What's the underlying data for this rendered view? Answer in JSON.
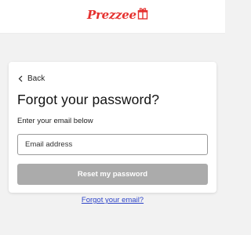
{
  "brand": {
    "logo_text": "Prezzee",
    "accent": "#e5302e"
  },
  "form": {
    "back_label": "Back",
    "title": "Forgot your password?",
    "hint": "Enter your email below",
    "email_placeholder": "Email address",
    "email_value": "",
    "submit_label": "Reset my password",
    "submit_disabled": true,
    "forgot_email_link": "Forgot your email?",
    "link_color": "#2f45c8"
  },
  "icons": {
    "back": "chevron-left-icon",
    "logo": "gift-icon"
  }
}
